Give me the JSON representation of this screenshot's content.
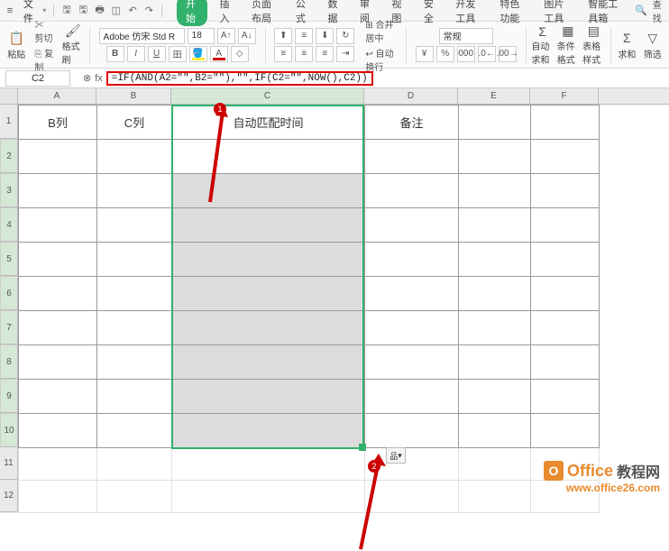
{
  "titlebar": {
    "file_label": "文件",
    "active_tab": "开始",
    "tabs": [
      "插入",
      "页面布局",
      "公式",
      "数据",
      "审阅",
      "视图",
      "安全",
      "开发工具",
      "特色功能",
      "图片工具",
      "智能工具箱"
    ],
    "search_label": "查找"
  },
  "ribbon": {
    "paste_label": "粘贴",
    "cut_label": "剪切",
    "copy_label": "复制",
    "format_painter": "格式刷",
    "font_name": "Adobe 仿宋 Std R",
    "font_size": "18",
    "wrap_label": "自动换行",
    "merge_label": "合并居中",
    "general_label": "常规",
    "autosum_label": "自动求和",
    "cond_format": "条件格式",
    "table_style": "表格样式",
    "sum_label": "求和",
    "filter_label": "筛选"
  },
  "formula": {
    "name_box": "C2",
    "fx_label": "fx",
    "formula_text": "=IF(AND(A2=\"\",B2=\"\"),\"\",IF(C2=\"\",NOW(),C2))"
  },
  "sheet": {
    "cols": [
      "A",
      "B",
      "C",
      "D",
      "E",
      "F"
    ],
    "rows": [
      "1",
      "2",
      "3",
      "4",
      "5",
      "6",
      "7",
      "8",
      "9",
      "10",
      "11",
      "12"
    ],
    "headers": {
      "A": "B列",
      "B": "C列",
      "C": "自动匹配时间",
      "D": "备注"
    }
  },
  "callouts": {
    "num1": "1",
    "num2": "2"
  },
  "paste_options": "品",
  "watermark": {
    "brand": "Office",
    "brand_cn": "教程网",
    "url": "www.office26.com"
  }
}
